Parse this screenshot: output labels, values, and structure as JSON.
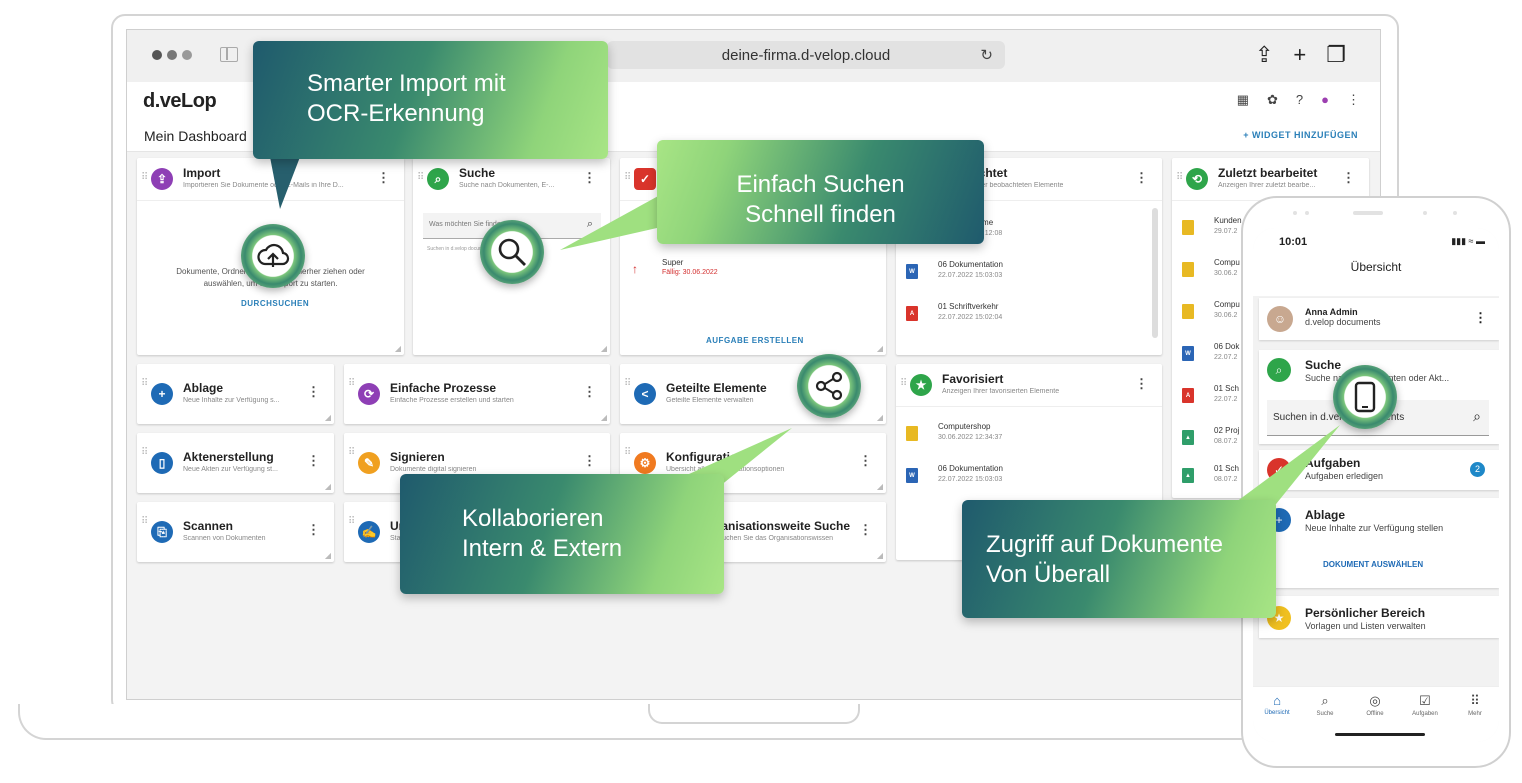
{
  "browser": {
    "url": "deine-firma.d-velop.cloud"
  },
  "app": {
    "logo": "d.veLop",
    "dashboard_title": "Mein Dashboard",
    "add_widget_label": "+ WIDGET HINZUFÜGEN"
  },
  "widgets": {
    "import": {
      "title": "Import",
      "subtitle": "Importieren Sie Dokumente oder E-Mails in Ihre D...",
      "drop_text": "Dokumente, Ordner oder E-Mails hierher ziehen oder auswählen, um den Import zu starten.",
      "action": "DURCHSUCHEN"
    },
    "suche": {
      "title": "Suche",
      "subtitle": "Suche nach Dokumenten, E-...",
      "placeholder": "Was möchten Sie finden?",
      "hint": "Suchen in d.velop documents"
    },
    "aufgaben": {
      "task_name": "Super",
      "task_due": "Fällig: 30.06.2022",
      "action": "AUFGABE ERSTELLEN"
    },
    "beobachtet": {
      "title": "Beobachtet",
      "subtitle": "Anzeigen Ihrer beobachteten Elemente",
      "items": [
        {
          "name": "Computerhome",
          "date": "30.06.2022 07:12:08"
        },
        {
          "name": "06 Dokumentation",
          "date": "22.07.2022 15:03:03"
        },
        {
          "name": "01 Schriftverkehr",
          "date": "22.07.2022 15:02:04"
        }
      ]
    },
    "zuletzt": {
      "title": "Zuletzt bearbeitet",
      "subtitle": "Anzeigen Ihrer zuletzt bearbe...",
      "items": [
        {
          "name": "Kunden",
          "date": "29.07.2"
        },
        {
          "name": "Compu",
          "date": "30.06.2"
        },
        {
          "name": "Compu",
          "date": "30.06.2"
        },
        {
          "name": "06 Dok",
          "date": "22.07.2"
        },
        {
          "name": "01 Sch",
          "date": "22.07.2"
        },
        {
          "name": "02 Proj",
          "date": "08.07.2"
        },
        {
          "name": "01 Sch",
          "date": "08.07.2"
        }
      ]
    },
    "ablage": {
      "title": "Ablage",
      "subtitle": "Neue Inhalte zur Verfügung s..."
    },
    "prozesse": {
      "title": "Einfache Prozesse",
      "subtitle": "Einfache Prozesse erstellen und starten"
    },
    "geteilt": {
      "title": "Geteilte Elemente",
      "subtitle": "Geteilte Elemente verwalten"
    },
    "favoriten": {
      "title": "Favorisiert",
      "subtitle": "Anzeigen Ihrer favorisierten Elemente",
      "items": [
        {
          "name": "Computershop",
          "date": "30.06.2022 12:34:37"
        },
        {
          "name": "06 Dokumentation",
          "date": "22.07.2022 15:03:03"
        }
      ]
    },
    "akten": {
      "title": "Aktenerstellung",
      "subtitle": "Neue Akten zur Verfügung st..."
    },
    "signieren": {
      "title": "Signieren",
      "subtitle": "Dokumente digital signieren"
    },
    "konfiguration": {
      "title": "Konfiguration",
      "subtitle": "Übersicht aller Konfigurationsoptionen"
    },
    "scannen": {
      "title": "Scannen",
      "subtitle": "Scannen von Dokumenten"
    },
    "unterschrift": {
      "title": "Un",
      "subtitle": "Sta"
    },
    "orgsuche": {
      "title": "Organisationsweite Suche",
      "subtitle": "Durchsuchen Sie das Organisationswissen"
    }
  },
  "callouts": {
    "import": "Smarter Import mit OCR-Erkennung",
    "suche_line1": "Einfach Suchen",
    "suche_line2": "Schnell finden",
    "kollab_line1": "Kollaborieren",
    "kollab_line2": "Intern & Extern",
    "mobile_line1": "Zugriff auf Dokumente",
    "mobile_line2": "Von Überall"
  },
  "phone": {
    "time": "10:01",
    "status": "▮▮▮ ≈ ▬",
    "title": "Übersicht",
    "user_name": "Anna Admin",
    "user_app": "d.velop documents",
    "suche_title": "Suche",
    "suche_sub": "Suche nach Dokumenten oder Akt...",
    "suche_placeholder": "Suchen in d.velop documents",
    "aufgaben_title": "Aufgaben",
    "aufgaben_sub": "Aufgaben erledigen",
    "aufgaben_count": "2",
    "ablage_title": "Ablage",
    "ablage_sub": "Neue Inhalte zur Verfügung stellen",
    "ablage_action": "DOKUMENT AUSWÄHLEN",
    "persoenlich_title": "Persönlicher Bereich",
    "persoenlich_sub": "Vorlagen und Listen verwalten",
    "tabs": [
      "Übersicht",
      "Suche",
      "Offline",
      "Aufgaben",
      "Mehr"
    ]
  },
  "colors": {
    "accent_blue": "#2a7fb8",
    "callout_dark": "#1f5a6d",
    "callout_light": "#a8e585",
    "due_red": "#d32f2f"
  }
}
